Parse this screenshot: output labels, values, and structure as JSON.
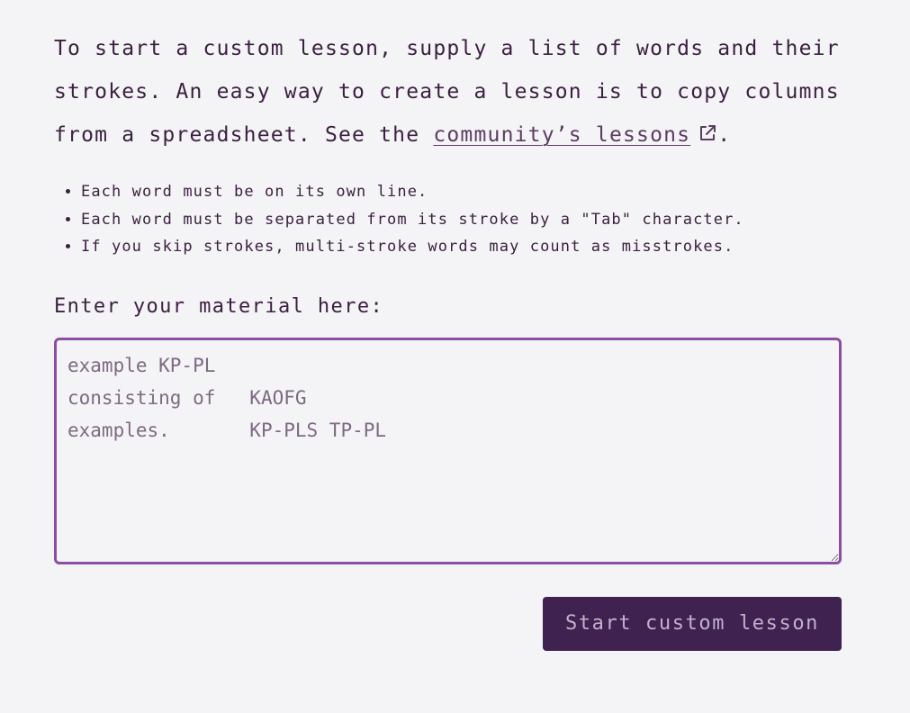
{
  "intro": {
    "text_before": "To start a custom lesson, supply a list of words and their strokes. An easy way to create a lesson is to copy columns from a spreadsheet. See the ",
    "link_label": "community’s lessons",
    "link_icon": "external-link-icon",
    "text_after": "."
  },
  "rules": [
    "Each word must be on its own line.",
    "Each word must be separated from its stroke by a \"Tab\" character.",
    "If you skip strokes, multi-stroke words may count as misstrokes."
  ],
  "material": {
    "label": "Enter your material here:",
    "placeholder": "example KP-PL\nconsisting of\tKAOFG\nexamples.\tKP-PLS TP-PL",
    "value": ""
  },
  "actions": {
    "start_label": "Start custom lesson"
  },
  "colors": {
    "background": "#f4f4f6",
    "text": "#3b2140",
    "textarea_border": "#8a4ea3",
    "button_bg": "#3f2250",
    "button_text": "#c3b1cb"
  }
}
